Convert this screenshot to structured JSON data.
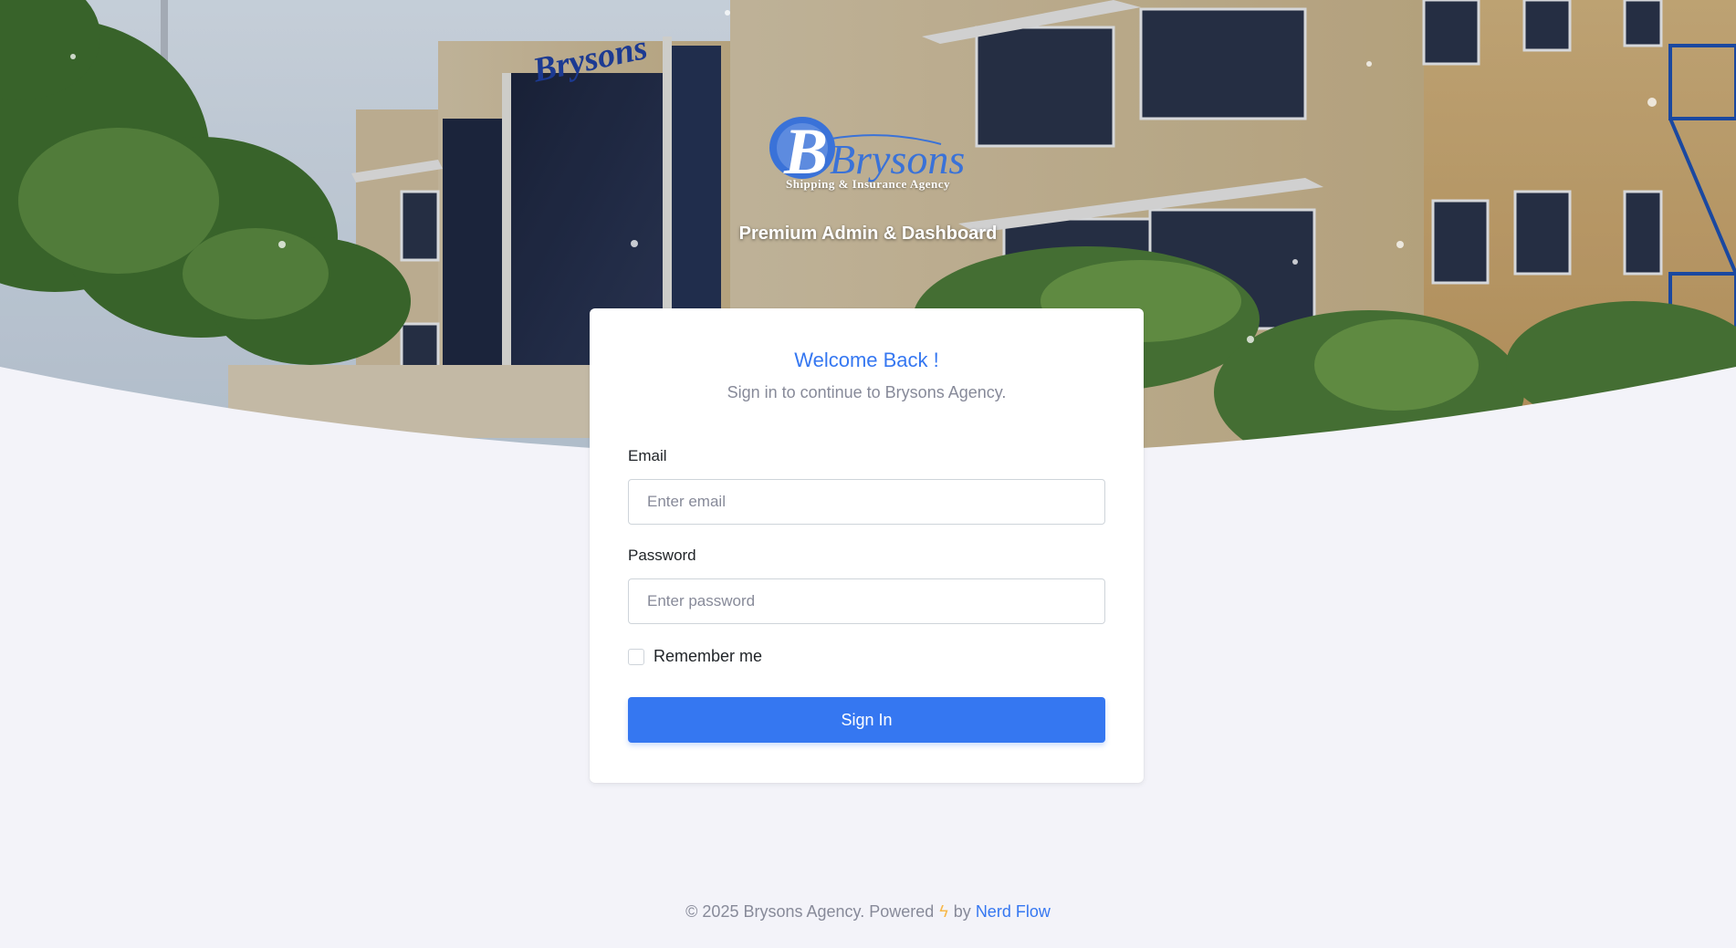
{
  "brand": {
    "logo_text": "Brysons",
    "logo_subtitle": "Shipping & Insurance Agency",
    "tagline": "Premium Admin & Dashboard"
  },
  "login": {
    "title": "Welcome Back !",
    "subtitle": "Sign in to continue to Brysons Agency.",
    "email_label": "Email",
    "email_placeholder": "Enter email",
    "password_label": "Password",
    "password_placeholder": "Enter password",
    "remember_label": "Remember me",
    "submit_label": "Sign In"
  },
  "footer": {
    "copyright": "© 2025 Brysons Agency. Powered",
    "by": "by",
    "link_text": "Nerd Flow",
    "icon": "bolt-icon"
  },
  "colors": {
    "primary": "#3577f1",
    "page_bg": "#f3f3f9",
    "muted": "#878a99",
    "accent": "#f7b84b"
  }
}
